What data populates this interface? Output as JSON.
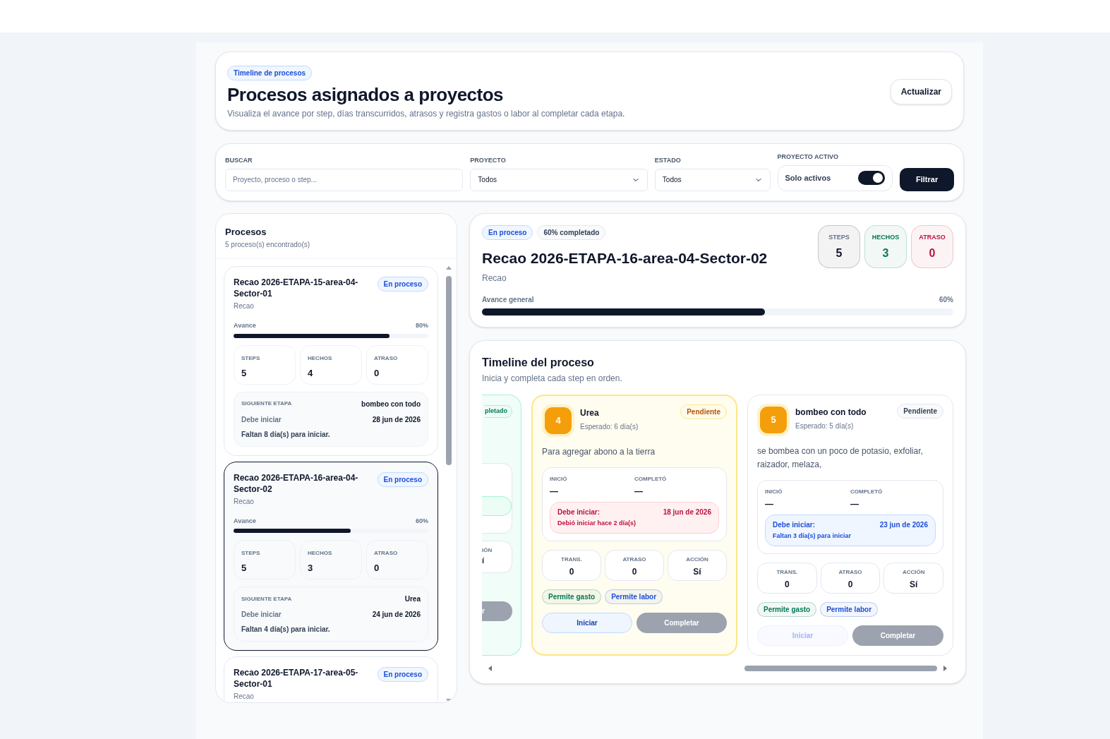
{
  "header": {
    "badge": "Timeline de procesos",
    "title": "Procesos asignados a proyectos",
    "subtitle": "Visualiza el avance por step, días transcurridos, atrasos y registra gastos o labor al completar cada etapa.",
    "refresh_button": "Actualizar"
  },
  "filters": {
    "search": {
      "label": "BUSCAR",
      "placeholder": "Proyecto, proceso o step..."
    },
    "project": {
      "label": "PROYECTO",
      "value": "Todos"
    },
    "status": {
      "label": "ESTADO",
      "value": "Todos"
    },
    "active": {
      "label": "PROYECTO ACTIVO",
      "text": "Solo activos",
      "on": true
    },
    "filter_button": "Filtrar"
  },
  "process_list": {
    "title": "Procesos",
    "count": "5 proceso(s) encontrado(s)",
    "items": [
      {
        "name": "Recao 2026-ETAPA-15-area-04-Sector-01",
        "status": "En proceso",
        "project": "Recao",
        "selected": false,
        "progress_label": "Avance",
        "progress_text": "80%",
        "level": 0.8,
        "stats": [
          {
            "label": "STEPS",
            "value": "5"
          },
          {
            "label": "HECHOS",
            "value": "4"
          },
          {
            "label": "ATRASO",
            "value": "0"
          }
        ],
        "next": {
          "label": "SIGUIENTE ETAPA",
          "step": "bombeo con todo",
          "due_label": "Debe iniciar",
          "due_date": "28 jun de 2026",
          "note": "Faltan 8 día(s) para iniciar."
        }
      },
      {
        "name": "Recao 2026-ETAPA-16-area-04-Sector-02",
        "status": "En proceso",
        "project": "Recao",
        "selected": true,
        "progress_label": "Avance",
        "progress_text": "60%",
        "level": 0.6,
        "stats": [
          {
            "label": "STEPS",
            "value": "5"
          },
          {
            "label": "HECHOS",
            "value": "3"
          },
          {
            "label": "ATRASO",
            "value": "0"
          }
        ],
        "next": {
          "label": "SIGUIENTE ETAPA",
          "step": "Urea",
          "due_label": "Debe iniciar",
          "due_date": "24 jun de 2026",
          "note": "Faltan 4 día(s) para iniciar."
        }
      },
      {
        "name": "Recao 2026-ETAPA-17-area-05-Sector-01",
        "status": "En proceso",
        "project": "Recao",
        "selected": false
      }
    ]
  },
  "detail": {
    "status": "En proceso",
    "completion": "60% completado",
    "title": "Recao 2026-ETAPA-16-area-04-Sector-02",
    "project": "Recao",
    "stats": [
      {
        "label": "STEPS",
        "value": "5",
        "color": "#0f172a"
      },
      {
        "label": "HECHOS",
        "value": "3",
        "color": "#047857"
      },
      {
        "label": "ATRASO",
        "value": "0",
        "color": "#be123c"
      }
    ],
    "progress_label": "Avance general",
    "progress_text": "60%",
    "level": 0.6
  },
  "timeline": {
    "title": "Timeline del proceso",
    "subtitle": "Inicia y completa cada step en orden.",
    "steps": [
      {
        "kind": "clipped",
        "status": "pletado",
        "action_label": "IÓN",
        "action_value": "í",
        "complete_button": "r"
      },
      {
        "kind": "full",
        "current": true,
        "number": "4",
        "name": "Urea",
        "expected": "Esperado: 6 día(s)",
        "status": "Pendiente",
        "description": "Para agregar abono a la tierra",
        "started_label": "INICIÓ",
        "started": "—",
        "completed_label": "COMPLETÓ",
        "completed": "—",
        "due": {
          "label": "Debe iniciar:",
          "date": "18 jun de 2026",
          "note": "Debió iniciar hace 2 día(s)",
          "overdue": true
        },
        "stats": [
          {
            "label": "TRANS.",
            "value": "0"
          },
          {
            "label": "ATRASO",
            "value": "0"
          },
          {
            "label": "ACCIÓN",
            "value": "Sí"
          }
        ],
        "tags": [
          {
            "text": "Permite gasto",
            "color": "#047857"
          },
          {
            "text": "Permite labor",
            "color": "#1d4ed8"
          }
        ],
        "start_button": {
          "text": "Iniciar",
          "disabled": false
        },
        "complete_button": {
          "text": "Completar",
          "disabled": true
        }
      },
      {
        "kind": "full",
        "current": false,
        "number": "5",
        "name": "bombeo con todo",
        "expected": "Esperado: 5 día(s)",
        "status": "Pendiente",
        "description": "se bombea con un poco de potasio, exfoliar, raizador, melaza,",
        "started_label": "INICIÓ",
        "started": "—",
        "completed_label": "COMPLETÓ",
        "completed": "—",
        "due": {
          "label": "Debe iniciar:",
          "date": "23 jun de 2026",
          "note": "Faltan 3 día(s) para iniciar",
          "overdue": false
        },
        "stats": [
          {
            "label": "TRANS.",
            "value": "0"
          },
          {
            "label": "ATRASO",
            "value": "0"
          },
          {
            "label": "ACCIÓN",
            "value": "Sí"
          }
        ],
        "tags": [
          {
            "text": "Permite gasto",
            "color": "#047857"
          },
          {
            "text": "Permite labor",
            "color": "#1d4ed8"
          }
        ],
        "start_button": {
          "text": "Iniciar",
          "disabled": true
        },
        "complete_button": {
          "text": "Completar",
          "disabled": true
        }
      }
    ]
  }
}
